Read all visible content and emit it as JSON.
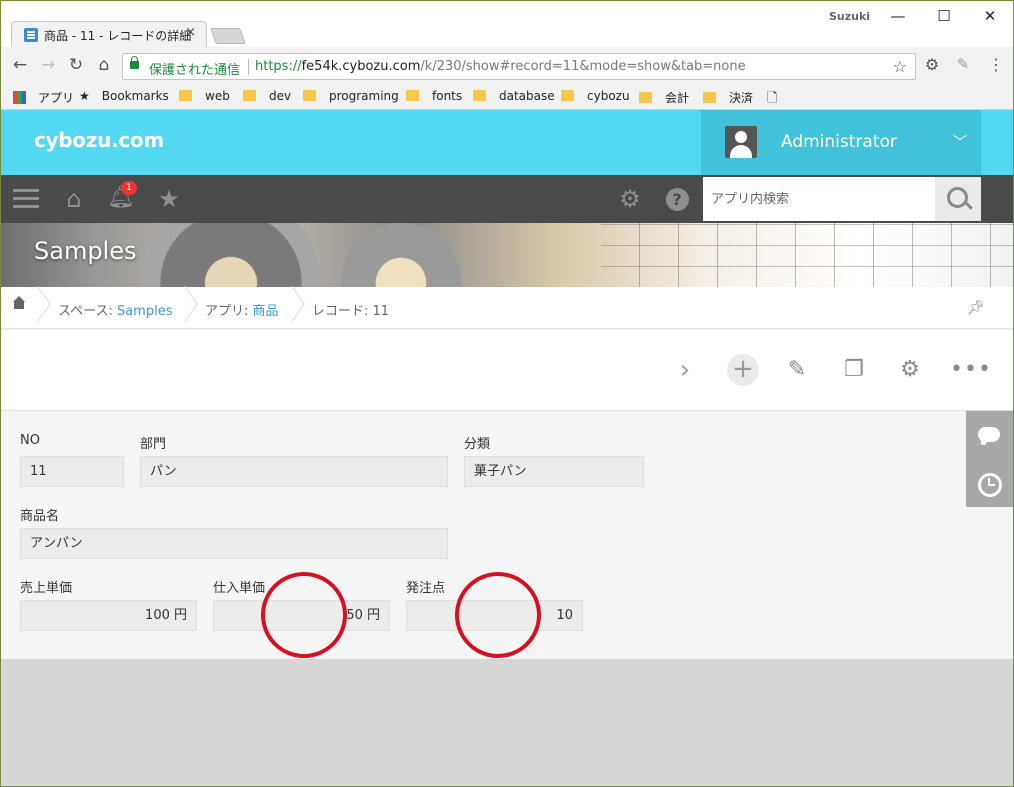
{
  "browser": {
    "tab_title": "商品 - 11 - レコードの詳細",
    "tab_close": "×",
    "os_user": "Suzuki",
    "window_buttons": {
      "minimize": "—",
      "maximize": "☐",
      "close": "✕"
    },
    "nav": {
      "back": "←",
      "forward": "→",
      "reload": "↻",
      "home": "⌂"
    },
    "secure_label": "保護された通信",
    "url_scheme": "https://",
    "url_host": "fe54k.cybozu.com",
    "url_path": "/k/230/show#record=11&mode=show&tab=none",
    "bookmarks": [
      "アプリ",
      "Bookmarks",
      "web",
      "dev",
      "programing",
      "fonts",
      "database",
      "cybozu",
      "会計",
      "決済"
    ]
  },
  "header": {
    "logo": "cybozu.com",
    "user_name": "Administrator",
    "notification_count": "1",
    "search_placeholder": "アプリ内検索"
  },
  "banner": {
    "title": "Samples"
  },
  "breadcrumb": {
    "space_prefix": "スペース: ",
    "space_name": "Samples",
    "app_prefix": "アプリ: ",
    "app_name": "商品",
    "record_label": "レコード: 11"
  },
  "record": {
    "no_label": "NO",
    "no_value": "11",
    "dept_label": "部門",
    "dept_value": "パン",
    "category_label": "分類",
    "category_value": "菓子パン",
    "product_label": "商品名",
    "product_value": "アンパン",
    "sale_price_label": "売上単価",
    "sale_price_value": "100 円",
    "cost_price_label": "仕入単価",
    "cost_price_value": "50 円",
    "reorder_label": "発注点",
    "reorder_value": "10"
  },
  "colors": {
    "header": "#52d9f1",
    "user_panel": "#3fc2da",
    "toolbar": "#4a4a4a",
    "link": "#3498db",
    "annotation": "#d80f1e"
  }
}
